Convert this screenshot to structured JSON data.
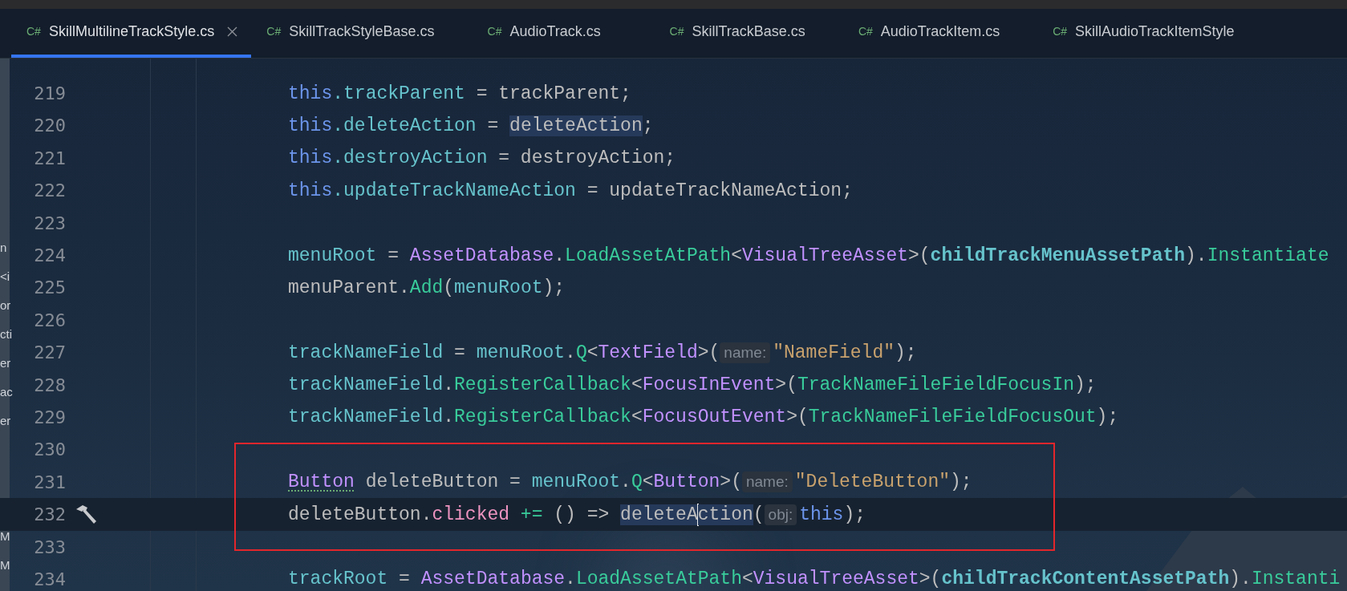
{
  "tabs": [
    {
      "icon_text": "C#",
      "label": "SkillMultilineTrackStyle.cs",
      "selected": true,
      "closable": true
    },
    {
      "icon_text": "C#",
      "label": "SkillTrackStyleBase.cs",
      "selected": false,
      "closable": false
    },
    {
      "icon_text": "C#",
      "label": "AudioTrack.cs",
      "selected": false,
      "closable": false
    },
    {
      "icon_text": "C#",
      "label": "SkillTrackBase.cs",
      "selected": false,
      "closable": false
    },
    {
      "icon_text": "C#",
      "label": "AudioTrackItem.cs",
      "selected": false,
      "closable": false
    },
    {
      "icon_text": "C#",
      "label": "SkillAudioTrackItemStyle",
      "selected": false,
      "closable": false
    }
  ],
  "side_panel": {
    "groups": [
      [
        "n",
        "<i",
        "or",
        "cti",
        "er",
        "ac",
        "er"
      ],
      [
        "M",
        "M"
      ]
    ]
  },
  "annotation_box": {
    "shown": true
  },
  "lines": [
    {
      "number": "219",
      "current": false,
      "tokens": [
        {
          "text": "this",
          "kind": "keyword"
        },
        {
          "text": ".trackParent",
          "kind": "field"
        },
        {
          "text": " = trackParent;",
          "kind": "plain"
        }
      ]
    },
    {
      "number": "220",
      "current": false,
      "tokens": [
        {
          "text": "this",
          "kind": "keyword"
        },
        {
          "text": ".deleteAction",
          "kind": "field"
        },
        {
          "text": " = ",
          "kind": "plain"
        },
        {
          "text": "deleteAction",
          "kind": "plain",
          "highlighted": true
        },
        {
          "text": ";",
          "kind": "plain"
        }
      ]
    },
    {
      "number": "221",
      "current": false,
      "tokens": [
        {
          "text": "this",
          "kind": "keyword"
        },
        {
          "text": ".destroyAction",
          "kind": "field"
        },
        {
          "text": " = destroyAction;",
          "kind": "plain"
        }
      ]
    },
    {
      "number": "222",
      "current": false,
      "tokens": [
        {
          "text": "this",
          "kind": "keyword"
        },
        {
          "text": ".updateTrackNameAction",
          "kind": "field"
        },
        {
          "text": " = updateTrackNameAction;",
          "kind": "plain"
        }
      ]
    },
    {
      "number": "223",
      "current": false
    },
    {
      "number": "224",
      "current": false,
      "tokens": [
        {
          "text": "menuRoot",
          "kind": "field"
        },
        {
          "text": " = ",
          "kind": "plain"
        },
        {
          "text": "AssetDatabase",
          "kind": "type"
        },
        {
          "text": ".",
          "kind": "plain"
        },
        {
          "text": "LoadAssetAtPath",
          "kind": "method"
        },
        {
          "text": "<",
          "kind": "plain"
        },
        {
          "text": "VisualTreeAsset",
          "kind": "type"
        },
        {
          "text": ">(",
          "kind": "plain"
        },
        {
          "text": "childTrackMenuAssetPath",
          "kind": "constant"
        },
        {
          "text": ").",
          "kind": "plain"
        },
        {
          "text": "Instantiate",
          "kind": "method"
        }
      ]
    },
    {
      "number": "225",
      "current": false,
      "tokens": [
        {
          "text": "menuParent.",
          "kind": "plain"
        },
        {
          "text": "Add",
          "kind": "method"
        },
        {
          "text": "(",
          "kind": "plain"
        },
        {
          "text": "menuRoot",
          "kind": "field"
        },
        {
          "text": ");",
          "kind": "plain"
        }
      ]
    },
    {
      "number": "226",
      "current": false
    },
    {
      "number": "227",
      "current": false,
      "tokens": [
        {
          "text": "trackNameField",
          "kind": "field"
        },
        {
          "text": " = ",
          "kind": "plain"
        },
        {
          "text": "menuRoot",
          "kind": "field"
        },
        {
          "text": ".",
          "kind": "plain"
        },
        {
          "text": "Q",
          "kind": "method"
        },
        {
          "text": "<",
          "kind": "plain"
        },
        {
          "text": "TextField",
          "kind": "type"
        },
        {
          "text": ">(",
          "kind": "plain"
        },
        {
          "text": "name:",
          "kind": "hint"
        },
        {
          "text": "\"NameField\"",
          "kind": "string"
        },
        {
          "text": ");",
          "kind": "plain"
        }
      ]
    },
    {
      "number": "228",
      "current": false,
      "tokens": [
        {
          "text": "trackNameField",
          "kind": "field"
        },
        {
          "text": ".",
          "kind": "plain"
        },
        {
          "text": "RegisterCallback",
          "kind": "method"
        },
        {
          "text": "<",
          "kind": "plain"
        },
        {
          "text": "FocusInEvent",
          "kind": "type"
        },
        {
          "text": ">(",
          "kind": "plain"
        },
        {
          "text": "TrackNameFileFieldFocusIn",
          "kind": "method"
        },
        {
          "text": ");",
          "kind": "plain"
        }
      ]
    },
    {
      "number": "229",
      "current": false,
      "tokens": [
        {
          "text": "trackNameField",
          "kind": "field"
        },
        {
          "text": ".",
          "kind": "plain"
        },
        {
          "text": "RegisterCallback",
          "kind": "method"
        },
        {
          "text": "<",
          "kind": "plain"
        },
        {
          "text": "FocusOutEvent",
          "kind": "type"
        },
        {
          "text": ">(",
          "kind": "plain"
        },
        {
          "text": "TrackNameFileFieldFocusOut",
          "kind": "method"
        },
        {
          "text": ");",
          "kind": "plain"
        }
      ]
    },
    {
      "number": "230",
      "current": false
    },
    {
      "number": "231",
      "current": false,
      "tokens": [
        {
          "text": "Button",
          "kind": "type",
          "underlined": true
        },
        {
          "text": " deleteButton = ",
          "kind": "plain"
        },
        {
          "text": "menuRoot",
          "kind": "field"
        },
        {
          "text": ".",
          "kind": "plain"
        },
        {
          "text": "Q",
          "kind": "method"
        },
        {
          "text": "<",
          "kind": "plain"
        },
        {
          "text": "Button",
          "kind": "type"
        },
        {
          "text": ">(",
          "kind": "plain"
        },
        {
          "text": "name:",
          "kind": "hint"
        },
        {
          "text": "\"DeleteButton\"",
          "kind": "string"
        },
        {
          "text": ");",
          "kind": "plain"
        }
      ]
    },
    {
      "number": "232",
      "current": true,
      "gutter_icon": true,
      "tokens": [
        {
          "text": "deleteButton.",
          "kind": "plain"
        },
        {
          "text": "clicked",
          "kind": "event"
        },
        {
          "text": " +=",
          "kind": "operator"
        },
        {
          "text": " () => ",
          "kind": "plain"
        },
        {
          "text": "deleteA",
          "kind": "plain",
          "highlighted": true,
          "caret": true
        },
        {
          "text": "ction",
          "kind": "plain",
          "highlighted": true
        },
        {
          "text": "(",
          "kind": "plain"
        },
        {
          "text": "obj:",
          "kind": "hint"
        },
        {
          "text": "this",
          "kind": "keyword"
        },
        {
          "text": ");",
          "kind": "plain"
        }
      ]
    },
    {
      "number": "233",
      "current": false
    },
    {
      "number": "234",
      "current": false,
      "tokens": [
        {
          "text": "trackRoot",
          "kind": "field"
        },
        {
          "text": " = ",
          "kind": "plain"
        },
        {
          "text": "AssetDatabase",
          "kind": "type"
        },
        {
          "text": ".",
          "kind": "plain"
        },
        {
          "text": "LoadAssetAtPath",
          "kind": "method"
        },
        {
          "text": "<",
          "kind": "plain"
        },
        {
          "text": "VisualTreeAsset",
          "kind": "type"
        },
        {
          "text": ">(",
          "kind": "plain"
        },
        {
          "text": "childTrackContentAssetPath",
          "kind": "constant"
        },
        {
          "text": ").",
          "kind": "plain"
        },
        {
          "text": "Instanti",
          "kind": "method"
        }
      ]
    }
  ]
}
